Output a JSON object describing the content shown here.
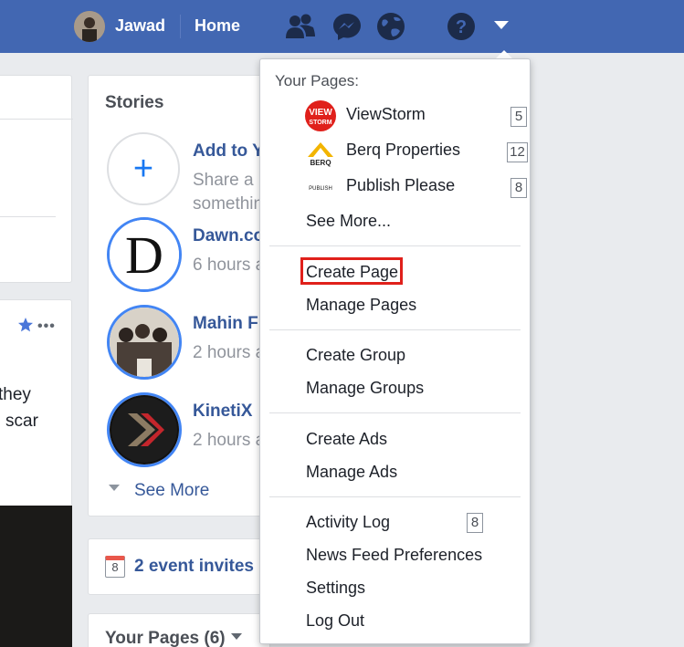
{
  "topbar": {
    "user_name": "Jawad",
    "home_label": "Home",
    "icons": [
      "friends-icon",
      "messenger-icon",
      "notifications-globe-icon",
      "help-icon",
      "account-menu-caret-icon"
    ]
  },
  "left_column": {
    "post_text_line1": "they",
    "post_text_line2": "scar"
  },
  "stories": {
    "title": "Stories",
    "items": [
      {
        "name": "Add to Y",
        "sub1": "Share a",
        "sub2": "somethin"
      },
      {
        "name": "Dawn.co",
        "sub": "6 hours a"
      },
      {
        "name": "Mahin F",
        "sub": "2 hours a"
      },
      {
        "name": "KinetiX",
        "sub": "2 hours a"
      }
    ],
    "see_more": "See More"
  },
  "events": {
    "label": "2 event invites",
    "calendar_day": "8"
  },
  "your_pages_card": {
    "label": "Your Pages (6)"
  },
  "dropdown": {
    "heading": "Your Pages:",
    "pages": [
      {
        "name": "ViewStorm",
        "badge": "5",
        "logo_text": "VIEW STORM"
      },
      {
        "name": "Berq Properties",
        "badge": "12",
        "logo_text": "BERQ"
      },
      {
        "name": "Publish Please",
        "badge": "8",
        "logo_text": "PUBLISH"
      }
    ],
    "see_more": "See More...",
    "create_page": "Create Page",
    "manage_pages": "Manage Pages",
    "create_group": "Create Group",
    "manage_groups": "Manage Groups",
    "create_ads": "Create Ads",
    "manage_ads": "Manage Ads",
    "activity_log": "Activity Log",
    "activity_log_badge": "8",
    "news_feed_prefs": "News Feed Preferences",
    "settings": "Settings",
    "log_out": "Log Out"
  },
  "colors": {
    "topbar": "#4267b2",
    "link": "#365899",
    "highlight": "#e0201b"
  }
}
